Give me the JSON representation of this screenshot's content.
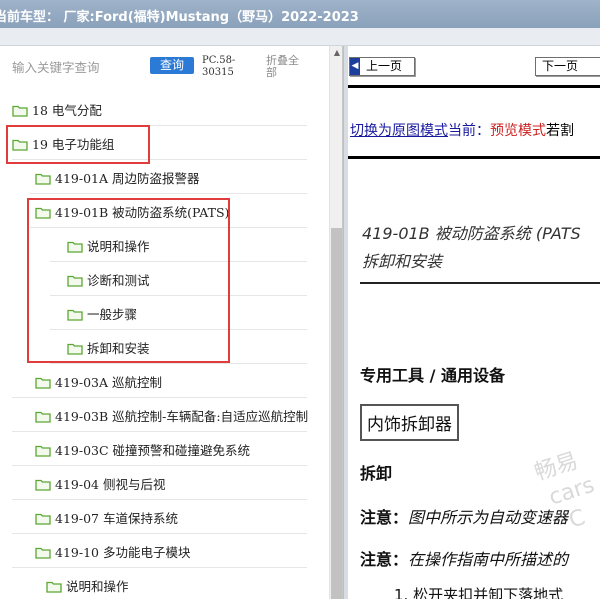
{
  "header": {
    "title": "当前车型： 厂家:Ford(福特)Mustang（野马）2022-2023"
  },
  "search": {
    "placeholder": "输入关键字查询",
    "button_label": "查询",
    "pc_code": "PC.58-30315",
    "collapse_label": "折叠全部"
  },
  "tree": [
    {
      "label": "18 电气分配"
    },
    {
      "label": "19 电子功能组"
    },
    {
      "label": "419-01A 周边防盗报警器"
    },
    {
      "label": "419-01B 被动防盗系统(PATS)"
    },
    {
      "label": "说明和操作"
    },
    {
      "label": "诊断和测试"
    },
    {
      "label": "一般步骤"
    },
    {
      "label": "拆卸和安装"
    },
    {
      "label": "419-03A 巡航控制"
    },
    {
      "label": "419-03B 巡航控制-车辆配备:自适应巡航控制"
    },
    {
      "label": "419-03C 碰撞预警和碰撞避免系统"
    },
    {
      "label": "419-04 侧视与后视"
    },
    {
      "label": "419-07 车道保持系统"
    },
    {
      "label": "419-10 多功能电子模块"
    },
    {
      "label": "说明和操作"
    }
  ],
  "viewer": {
    "prev_page": "上一页",
    "next_page": "下一页",
    "switch_link": "切换为原图模式",
    "current_label": "当前：",
    "preview_label": "预览模式",
    "if_label": "若割",
    "doc_title_line1": "419-01B 被动防盗系统 (PATS",
    "doc_title_line2": "拆卸和安装",
    "tools_heading": "专用工具 / 通用设备",
    "tool_box": "内饰拆卸器",
    "remove_heading": "拆卸",
    "note1_label": "注意：",
    "note1_text": "图中所示为自动变速器",
    "note2_label": "注意：",
    "note2_text": "在操作指南中所描述的",
    "step1": "1. 松开夹扣并卸下落地式",
    "watermark_line1": "畅易",
    "watermark_line2": "cars",
    "watermark_line3": "C"
  },
  "colors": {
    "accent": "#2b7bd6",
    "highlight_box": "#e03c3c",
    "folder": "#5aa832",
    "link": "#1a1a9e",
    "preview": "#cc2222"
  }
}
